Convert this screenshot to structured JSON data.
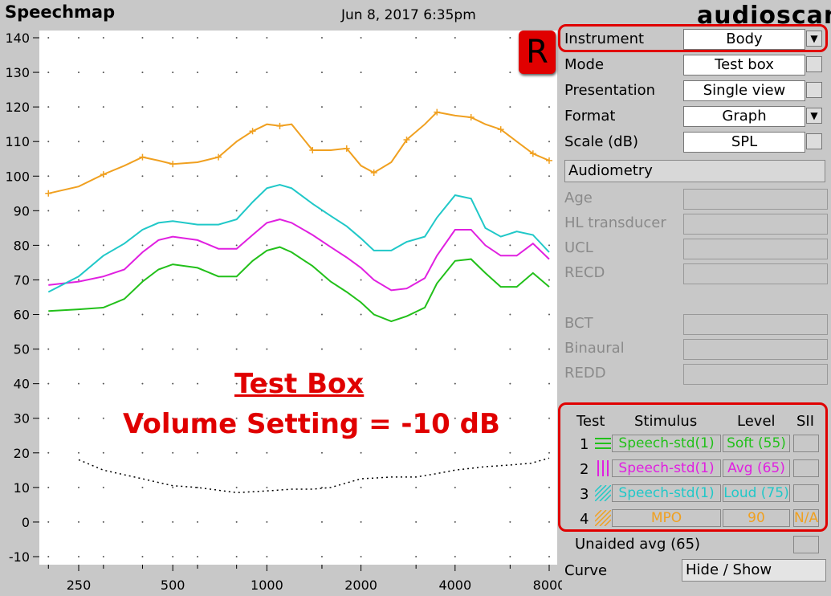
{
  "header": {
    "title": "Speechmap",
    "date": "Jun 8, 2017 6:35pm",
    "logo": "audioscan"
  },
  "chart_data": {
    "type": "line",
    "x_scale": "log",
    "x_ticks": [
      250,
      500,
      1000,
      2000,
      4000,
      8000
    ],
    "x_tick_labels": [
      "250",
      "500",
      "1000",
      "2000",
      "4000",
      "8000"
    ],
    "y_ticks": [
      140,
      130,
      120,
      110,
      100,
      90,
      80,
      70,
      60,
      50,
      40,
      30,
      20,
      10,
      0,
      -10
    ],
    "ylim": [
      -10,
      140
    ],
    "xlim": [
      200,
      8000
    ],
    "grid": "dotted",
    "series": [
      {
        "name": "Speech-std(1) Soft (55)",
        "color": "#22c01a",
        "style": "solid",
        "x": [
          200,
          250,
          300,
          350,
          400,
          450,
          500,
          600,
          700,
          800,
          900,
          1000,
          1100,
          1200,
          1400,
          1600,
          1800,
          2000,
          2200,
          2500,
          2800,
          3200,
          3500,
          4000,
          4500,
          5000,
          5600,
          6300,
          7100,
          8000
        ],
        "y": [
          61,
          61.5,
          62,
          64.5,
          69.5,
          73,
          74.5,
          73.5,
          71,
          71,
          75.5,
          78.5,
          79.5,
          78,
          74,
          69.5,
          66.5,
          63.5,
          60,
          58,
          59.5,
          62,
          69,
          75.5,
          76,
          72,
          68,
          68,
          72,
          68
        ]
      },
      {
        "name": "Speech-std(1) Avg (65)",
        "color": "#e020e0",
        "style": "solid",
        "x": [
          200,
          250,
          300,
          350,
          400,
          450,
          500,
          600,
          700,
          800,
          900,
          1000,
          1100,
          1200,
          1400,
          1600,
          1800,
          2000,
          2200,
          2500,
          2800,
          3200,
          3500,
          4000,
          4500,
          5000,
          5600,
          6300,
          7100,
          8000
        ],
        "y": [
          68.5,
          69.5,
          71,
          73,
          78,
          81.5,
          82.5,
          81.5,
          79,
          79,
          83,
          86.5,
          87.5,
          86.5,
          83,
          79.5,
          76.5,
          73.5,
          70,
          67,
          67.5,
          70.5,
          77,
          84.5,
          84.5,
          80,
          77,
          77,
          80.5,
          76
        ]
      },
      {
        "name": "Speech-std(1) Loud (75)",
        "color": "#20c8c8",
        "style": "solid",
        "x": [
          200,
          250,
          300,
          350,
          400,
          450,
          500,
          600,
          700,
          800,
          900,
          1000,
          1100,
          1200,
          1400,
          1600,
          1800,
          2000,
          2200,
          2500,
          2800,
          3200,
          3500,
          4000,
          4500,
          5000,
          5600,
          6300,
          7100,
          8000
        ],
        "y": [
          66.5,
          71,
          77,
          80.5,
          84.5,
          86.5,
          87,
          86,
          86,
          87.5,
          92.5,
          96.5,
          97.5,
          96.5,
          92,
          88.5,
          85.5,
          82,
          78.5,
          78.5,
          81,
          82.5,
          88,
          94.5,
          93.5,
          85,
          82.5,
          84,
          83,
          78
        ]
      },
      {
        "name": "MPO 90",
        "color": "#f0a020",
        "style": "solid",
        "x": [
          200,
          250,
          300,
          350,
          400,
          450,
          500,
          600,
          700,
          800,
          900,
          1000,
          1100,
          1200,
          1400,
          1600,
          1800,
          2000,
          2200,
          2500,
          2800,
          3200,
          3500,
          4000,
          4500,
          5000,
          5600,
          6300,
          7100,
          8000
        ],
        "y": [
          95,
          97,
          100.5,
          103,
          105.5,
          104.5,
          103.5,
          104,
          105.5,
          110,
          113,
          115,
          114.5,
          115,
          107.5,
          107.5,
          108,
          103,
          101,
          104,
          110.5,
          115,
          118.5,
          117.5,
          117,
          115,
          113.5,
          110,
          106.5,
          104.5
        ]
      },
      {
        "name": "",
        "color": "#000000",
        "style": "dotted",
        "x": [
          250,
          300,
          400,
          500,
          600,
          800,
          1000,
          1200,
          1400,
          1600,
          2000,
          2500,
          3000,
          3500,
          4000,
          5000,
          6000,
          7000,
          8000
        ],
        "y": [
          18,
          15,
          12.5,
          10.5,
          10,
          8.5,
          9,
          9.5,
          9.5,
          10,
          12.5,
          13,
          13,
          14,
          15,
          16,
          16.5,
          17,
          18.5
        ]
      }
    ]
  },
  "badge": "R",
  "annotation": {
    "line1": "Test Box",
    "line2": "Volume Setting = -10 dB"
  },
  "settings": [
    {
      "label": "Instrument",
      "value": "Body",
      "control": "dropdown"
    },
    {
      "label": "Mode",
      "value": "Test box",
      "control": "checkbox"
    },
    {
      "label": "Presentation",
      "value": "Single view",
      "control": "checkbox"
    },
    {
      "label": "Format",
      "value": "Graph",
      "control": "dropdown"
    },
    {
      "label": "Scale (dB)",
      "value": "SPL",
      "control": "checkbox"
    }
  ],
  "audiometry": {
    "button": "Audiometry",
    "fields": [
      "Age",
      "HL transducer",
      "UCL",
      "RECD",
      "BCT",
      "Binaural",
      "REDD"
    ]
  },
  "tests": {
    "headers": {
      "test": "Test",
      "stimulus": "Stimulus",
      "level": "Level",
      "sii": "SII"
    },
    "rows": [
      {
        "num": "1",
        "stimulus": "Speech-std(1)",
        "level": "Soft (55)",
        "sii": "",
        "color": "#22c01a"
      },
      {
        "num": "2",
        "stimulus": "Speech-std(1)",
        "level": "Avg (65)",
        "sii": "",
        "color": "#e020e0"
      },
      {
        "num": "3",
        "stimulus": "Speech-std(1)",
        "level": "Loud (75)",
        "sii": "",
        "color": "#20c8c8"
      },
      {
        "num": "4",
        "stimulus": "MPO",
        "level": "90",
        "sii": "N/A",
        "color": "#f0a020"
      }
    ]
  },
  "unaided": "Unaided avg (65)",
  "curve": {
    "label": "Curve",
    "button": "Hide / Show"
  }
}
